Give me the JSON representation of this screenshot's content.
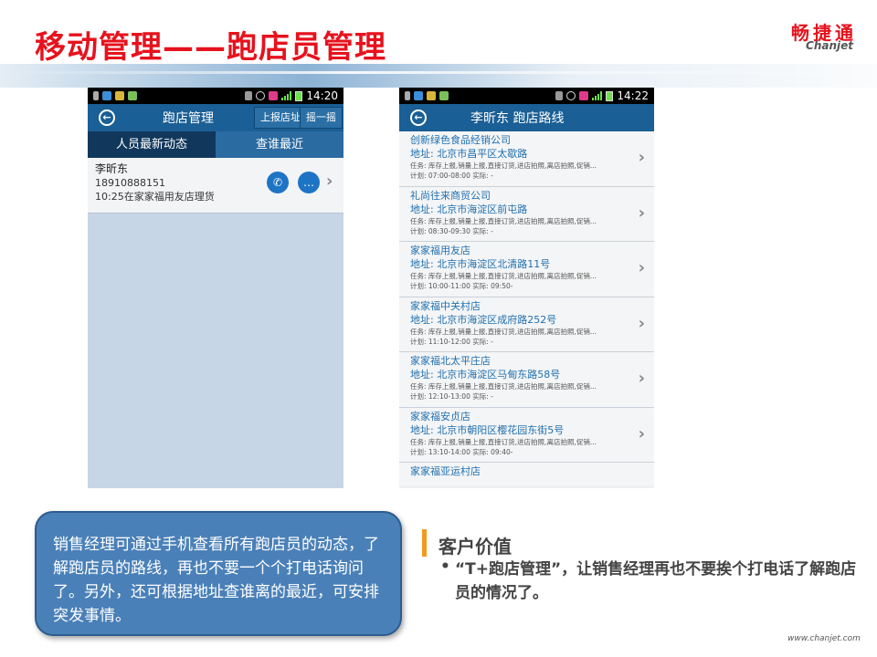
{
  "slide": {
    "title": "移动管理——跑店员管理",
    "logo_cn": "畅捷通",
    "logo_en": "Chanjet",
    "footer_url": "www.chanjet.com"
  },
  "colors": {
    "title_red": "#e6121d",
    "appbar_blue": "#1a5f95",
    "callout_blue": "#4a80b8",
    "accent_orange": "#f39a1e"
  },
  "phone1": {
    "status_time": "14:20",
    "title": "跑店管理",
    "report_btn": "上报店址",
    "shake_btn": "摇一摇",
    "tabs": [
      {
        "label": "人员最新动态",
        "active": true
      },
      {
        "label": "查谁最近",
        "active": false
      }
    ],
    "person": {
      "name": "李昕东",
      "phone": "18910888151",
      "activity": "10:25在家家福用友店理货",
      "call_icon": "phone-icon",
      "msg_icon": "message-icon"
    }
  },
  "phone2": {
    "status_time": "14:22",
    "title": "李昕东 跑店路线",
    "routes": [
      {
        "name": "创新绿色食品经销公司",
        "address": "地址: 北京市昌平区太歇路",
        "task": "任务: 库存上报,销量上报,直接订货,进店拍照,离店拍照,促销...",
        "plan": "计划: 07:00-08:00    实际: -"
      },
      {
        "name": "礼尚往来商贸公司",
        "address": "地址: 北京市海淀区前屯路",
        "task": "任务: 库存上报,销量上报,直接订货,进店拍照,离店拍照,促销...",
        "plan": "计划: 08:30-09:30    实际: -"
      },
      {
        "name": "家家福用友店",
        "address": "地址: 北京市海淀区北清路11号",
        "task": "任务: 库存上报,销量上报,直接订货,进店拍照,离店拍照,促销...",
        "plan": "计划: 10:00-11:00    实际: 09:50-"
      },
      {
        "name": "家家福中关村店",
        "address": "地址: 北京市海淀区成府路252号",
        "task": "任务: 库存上报,销量上报,直接订货,进店拍照,离店拍照,促销...",
        "plan": "计划: 11:10-12:00    实际: -"
      },
      {
        "name": "家家福北太平庄店",
        "address": "地址: 北京市海淀区马甸东路58号",
        "task": "任务: 库存上报,销量上报,直接订货,进店拍照,离店拍照,促销...",
        "plan": "计划: 12:10-13:00    实际: -"
      },
      {
        "name": "家家福安贞店",
        "address": "地址: 北京市朝阳区樱花园东街5号",
        "task": "任务: 库存上报,销量上报,直接订货,进店拍照,离店拍照,促销...",
        "plan": "计划: 13:10-14:00    实际: 09:40-"
      }
    ],
    "partial_route": "家家福亚运村店"
  },
  "callout": {
    "text": "销售经理可通过手机查看所有跑店员的动态，了解跑店员的路线，再也不要一个个打电话询问了。另外，还可根据地址查谁离的最近，可安排突发事情。"
  },
  "customer_value": {
    "title": "客户价值",
    "bullet": "•",
    "text": "“T+跑店管理”，让销售经理再也不要挨个打电话了解跑店员的情况了。"
  }
}
